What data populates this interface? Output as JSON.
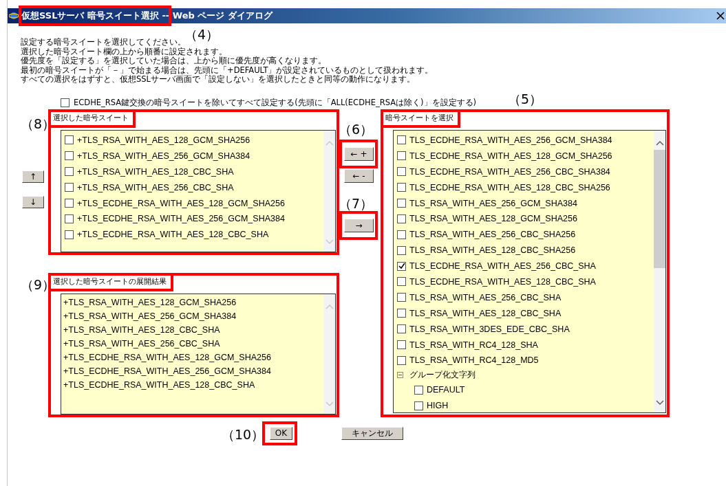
{
  "window": {
    "title": "仮想SSLサーバ 暗号スイート選択 -- Web ページ ダイアログ",
    "highlighted": true
  },
  "instructions": [
    "設定する暗号スイートを選択してください。",
    "選択した暗号スイート欄の上から順番に設定されます。",
    "優先度を「設定する」を選択していた場合は、上から順に優先度が高くなります。",
    "最初の暗号スイートが「－」で始まる場合は、先頭に「+DEFAULT」が設定されているものとして扱われます。",
    "すべての選択をはずすと、仮想SSLサーバ画面で「設定しない」を選択したときと同等の動作になります。"
  ],
  "exclude_option": {
    "label": "ECDHE_RSA鍵交換の暗号スイートを除いてすべて設定する(先頭に「ALL(ECDHE_RSAは除く)」を設定する)",
    "checked": false
  },
  "order_buttons": [
    {
      "label": "↑"
    },
    {
      "label": "↓"
    }
  ],
  "selected_suites": {
    "title": "選択した暗号スイート",
    "items": [
      {
        "label": "+TLS_RSA_WITH_AES_128_GCM_SHA256",
        "checked": false
      },
      {
        "label": "+TLS_RSA_WITH_AES_256_GCM_SHA384",
        "checked": false
      },
      {
        "label": "+TLS_RSA_WITH_AES_128_CBC_SHA",
        "checked": false
      },
      {
        "label": "+TLS_RSA_WITH_AES_256_CBC_SHA",
        "checked": false
      },
      {
        "label": "+TLS_ECDHE_RSA_WITH_AES_128_GCM_SHA256",
        "checked": false
      },
      {
        "label": "+TLS_ECDHE_RSA_WITH_AES_256_GCM_SHA384",
        "checked": false
      },
      {
        "label": "+TLS_ECDHE_RSA_WITH_AES_128_CBC_SHA",
        "checked": false
      }
    ]
  },
  "transfer_buttons": [
    {
      "label": "← +",
      "highlighted": true
    },
    {
      "label": "← -",
      "highlighted": false
    },
    {
      "label": "→",
      "highlighted": true
    }
  ],
  "expanded_result": {
    "title": "選択した暗号スイートの展開結果",
    "lines": [
      "+TLS_RSA_WITH_AES_128_GCM_SHA256",
      "+TLS_RSA_WITH_AES_256_GCM_SHA384",
      "+TLS_RSA_WITH_AES_128_CBC_SHA",
      "+TLS_RSA_WITH_AES_256_CBC_SHA",
      "+TLS_ECDHE_RSA_WITH_AES_128_GCM_SHA256",
      "+TLS_ECDHE_RSA_WITH_AES_256_GCM_SHA384",
      "+TLS_ECDHE_RSA_WITH_AES_128_CBC_SHA"
    ]
  },
  "available_suites": {
    "title": "暗号スイートを選択",
    "items": [
      {
        "label": "TLS_ECDHE_RSA_WITH_AES_256_GCM_SHA384",
        "checked": false
      },
      {
        "label": "TLS_ECDHE_RSA_WITH_AES_128_GCM_SHA256",
        "checked": false
      },
      {
        "label": "TLS_ECDHE_RSA_WITH_AES_256_CBC_SHA384",
        "checked": false
      },
      {
        "label": "TLS_ECDHE_RSA_WITH_AES_128_CBC_SHA256",
        "checked": false
      },
      {
        "label": "TLS_RSA_WITH_AES_256_GCM_SHA384",
        "checked": false
      },
      {
        "label": "TLS_RSA_WITH_AES_128_GCM_SHA256",
        "checked": false
      },
      {
        "label": "TLS_RSA_WITH_AES_256_CBC_SHA256",
        "checked": false
      },
      {
        "label": "TLS_RSA_WITH_AES_128_CBC_SHA256",
        "checked": false
      },
      {
        "label": "TLS_ECDHE_RSA_WITH_AES_256_CBC_SHA",
        "checked": true
      },
      {
        "label": "TLS_ECDHE_RSA_WITH_AES_128_CBC_SHA",
        "checked": false
      },
      {
        "label": "TLS_RSA_WITH_AES_256_CBC_SHA",
        "checked": false
      },
      {
        "label": "TLS_RSA_WITH_AES_128_CBC_SHA",
        "checked": false
      },
      {
        "label": "TLS_RSA_WITH_3DES_EDE_CBC_SHA",
        "checked": false
      },
      {
        "label": "TLS_RSA_WITH_RC4_128_SHA",
        "checked": false
      },
      {
        "label": "TLS_RSA_WITH_RC4_128_MD5",
        "checked": false
      }
    ],
    "group": {
      "label": "グループ化文字列",
      "expanded": true,
      "children": [
        {
          "label": "DEFAULT",
          "checked": false
        },
        {
          "label": "HIGH",
          "checked": false
        }
      ]
    }
  },
  "buttons": [
    {
      "label": "OK",
      "highlighted": true
    },
    {
      "label": "キャンセル",
      "highlighted": false
    }
  ],
  "callouts": [
    "（4）",
    "（5）",
    "（6）",
    "（7）",
    "（8）",
    "（9）",
    "（10）"
  ]
}
